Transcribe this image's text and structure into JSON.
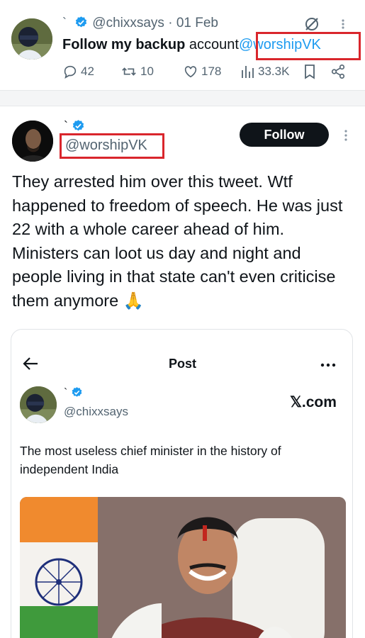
{
  "tweet1": {
    "display_name": "`",
    "handle": "@chixxsays",
    "separator": "·",
    "date": "01 Feb",
    "text_bold": "Follow my backup",
    "text_plain": "account",
    "mention": "@worshipVK",
    "stats": {
      "replies": "42",
      "reposts": "10",
      "likes": "178",
      "views": "33.3K"
    }
  },
  "tweet2": {
    "display_name": "`",
    "handle": "@worshipVK",
    "follow_label": "Follow",
    "body": "They arrested him over this tweet. Wtf happened to freedom of speech. He was just 22 with a whole career ahead of him. Ministers can loot us day and night and people living in that state can't even criticise them anymore 🙏"
  },
  "embedded_post": {
    "header_title": "Post",
    "display_name": "`",
    "handle": "@chixxsays",
    "site": "𝕏.com",
    "text": "The most useless chief minister in the history of independent India"
  },
  "colors": {
    "accent": "#1d9bf0",
    "highlight_box": "#d9262c",
    "text_primary": "#0f1419",
    "text_secondary": "#536471"
  },
  "icons": [
    "verified-badge-icon",
    "grok-icon",
    "more-icon",
    "reply-icon",
    "repost-icon",
    "like-icon",
    "views-icon",
    "bookmark-icon",
    "share-icon",
    "back-arrow-icon"
  ]
}
